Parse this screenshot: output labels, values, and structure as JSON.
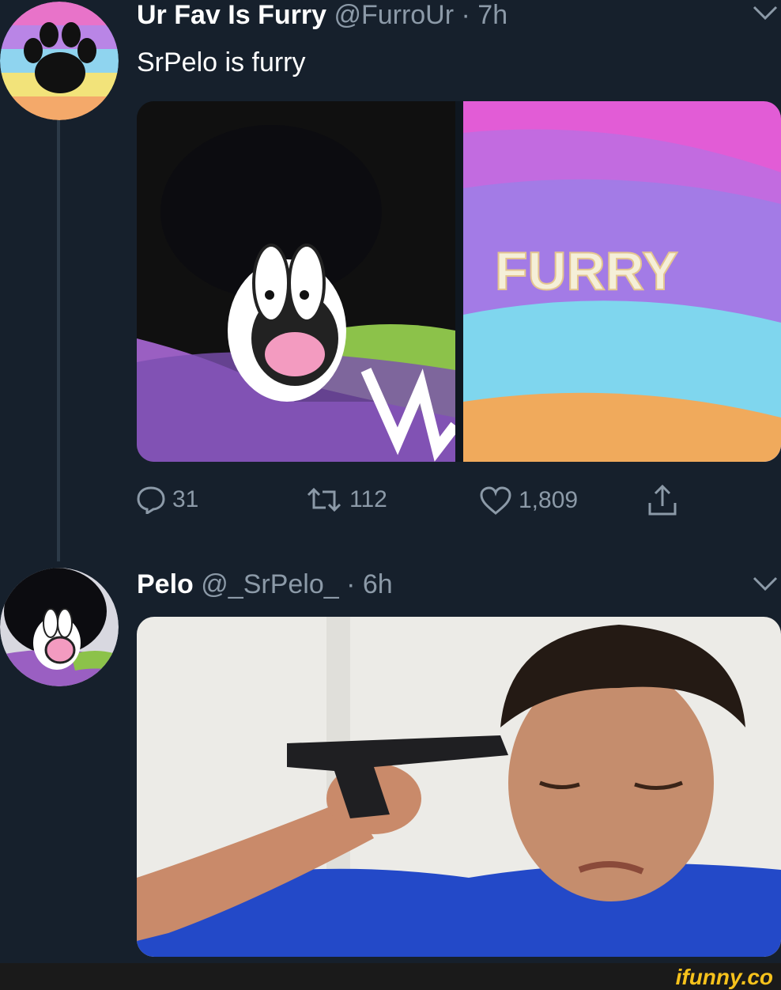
{
  "tweet1": {
    "display_name": "Ur Fav Is Furry",
    "handle": "@FurroUr",
    "time": "· 7h",
    "text": "SrPelo is furry",
    "image_text": "FURRY",
    "actions": {
      "replies": "31",
      "retweets": "112",
      "likes": "1,809"
    }
  },
  "tweet2": {
    "display_name": "Pelo",
    "handle": "@_SrPelo_",
    "time": "· 6h"
  },
  "watermark": "ifunny.co",
  "colors": {
    "background": "#16202c",
    "secondary_text": "#8c9aa8",
    "thread_line": "#2c3a48"
  },
  "icons": [
    "paw-icon",
    "chevron-down-icon",
    "reply-icon",
    "retweet-icon",
    "like-icon",
    "share-icon"
  ]
}
